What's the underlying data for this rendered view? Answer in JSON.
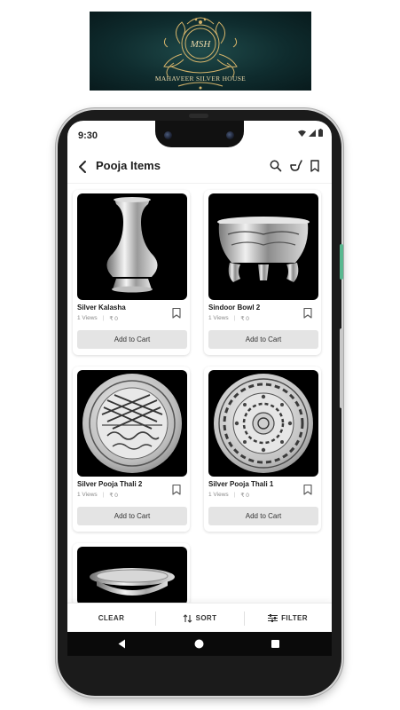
{
  "brand": {
    "monogram": "MSH",
    "name": "MAHAVEER SILVER HOUSE",
    "bg_color": "#0f2c2e",
    "accent_color": "#d4b36a"
  },
  "status_bar": {
    "time": "9:30",
    "icons": [
      "wifi-icon",
      "signal-icon",
      "battery-icon"
    ]
  },
  "header": {
    "title": "Pooja Items",
    "icons": [
      "back-arrow-icon",
      "search-icon",
      "ladle-icon",
      "bookmark-icon"
    ]
  },
  "products": [
    {
      "name": "Silver Kalasha",
      "views": "1 Views",
      "price": "₹ 0",
      "button": "Add to Cart"
    },
    {
      "name": "Sindoor Bowl 2",
      "views": "1 Views",
      "price": "₹ 0",
      "button": "Add to Cart"
    },
    {
      "name": "Silver Pooja Thali 2",
      "views": "1 Views",
      "price": "₹ 0",
      "button": "Add to Cart"
    },
    {
      "name": "Silver Pooja Thali 1",
      "views": "1 Views",
      "price": "₹ 0",
      "button": "Add to Cart"
    }
  ],
  "bottom_bar": {
    "clear": "CLEAR",
    "sort": "SORT",
    "filter": "FILTER"
  },
  "nav_bar": {
    "icons": [
      "back-triangle-icon",
      "home-circle-icon",
      "recents-square-icon"
    ]
  }
}
